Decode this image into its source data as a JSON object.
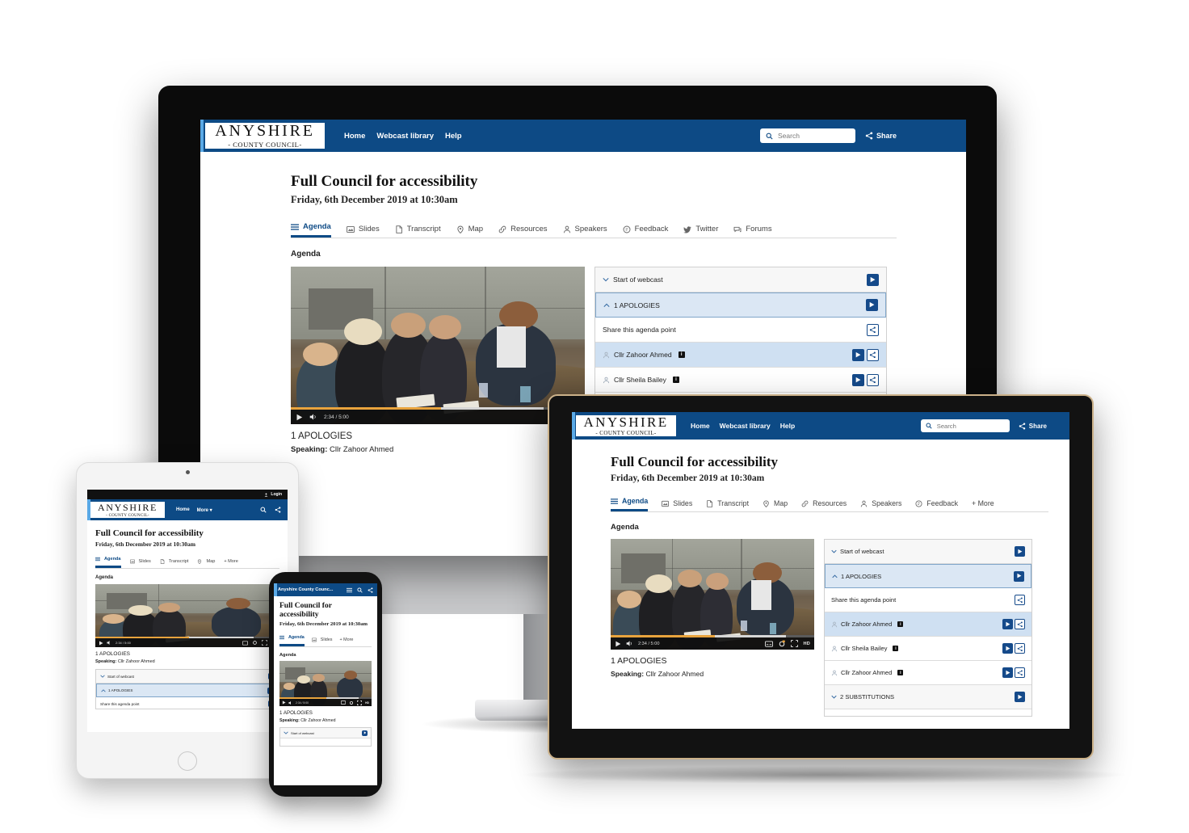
{
  "brand": {
    "logo_line1": "ANYSHIRE",
    "logo_line2": "- COUNTY COUNCIL-",
    "logo_short": "Anyshire County Counc...",
    "primary_color": "#0d4a85",
    "accent_color": "#5aa9e6",
    "button_blue": "#154a8a"
  },
  "nav": {
    "home": "Home",
    "webcast_library": "Webcast library",
    "help": "Help",
    "more": "More",
    "more_caret": "More ▾",
    "login": "Login",
    "share": "Share",
    "search_placeholder": "Search",
    "search_value": ""
  },
  "page": {
    "title": "Full Council for accessibility",
    "subtitle": "Friday, 6th December 2019 at 10:30am",
    "section_label": "Agenda"
  },
  "tabs_desktop": [
    {
      "label": "Agenda",
      "icon": "list-icon",
      "active": true
    },
    {
      "label": "Slides",
      "icon": "slides-icon",
      "active": false
    },
    {
      "label": "Transcript",
      "icon": "document-icon",
      "active": false
    },
    {
      "label": "Map",
      "icon": "map-pin-icon",
      "active": false
    },
    {
      "label": "Resources",
      "icon": "link-icon",
      "active": false
    },
    {
      "label": "Speakers",
      "icon": "person-icon",
      "active": false
    },
    {
      "label": "Feedback",
      "icon": "comment-icon",
      "active": false
    },
    {
      "label": "Twitter",
      "icon": "twitter-icon",
      "active": false
    },
    {
      "label": "Forums",
      "icon": "forums-icon",
      "active": false
    }
  ],
  "tabs_laptop": [
    {
      "label": "Agenda",
      "icon": "list-icon",
      "active": true
    },
    {
      "label": "Slides",
      "icon": "slides-icon",
      "active": false
    },
    {
      "label": "Transcript",
      "icon": "document-icon",
      "active": false
    },
    {
      "label": "Map",
      "icon": "map-pin-icon",
      "active": false
    },
    {
      "label": "Resources",
      "icon": "link-icon",
      "active": false
    },
    {
      "label": "Speakers",
      "icon": "person-icon",
      "active": false
    },
    {
      "label": "Feedback",
      "icon": "comment-icon",
      "active": false
    },
    {
      "label": "+ More",
      "icon": "plus-icon",
      "active": false
    }
  ],
  "tabs_tablet": [
    {
      "label": "Agenda",
      "icon": "list-icon",
      "active": true
    },
    {
      "label": "Slides",
      "icon": "slides-icon",
      "active": false
    },
    {
      "label": "Transcript",
      "icon": "document-icon",
      "active": false
    },
    {
      "label": "Map",
      "icon": "map-pin-icon",
      "active": false
    },
    {
      "label": "+ More",
      "icon": "plus-icon",
      "active": false
    }
  ],
  "tabs_phone": [
    {
      "label": "Agenda",
      "icon": "list-icon",
      "active": true
    },
    {
      "label": "Slides",
      "icon": "slides-icon",
      "active": false
    },
    {
      "label": "+ More",
      "icon": "plus-icon",
      "active": false
    }
  ],
  "player": {
    "current_time": "2:34",
    "duration": "5:00",
    "time_display": "2:34 / 5:00",
    "progress_percent": 51,
    "buffered_percent": 86,
    "quality": "HD",
    "controls": [
      "play-icon",
      "volume-icon",
      "captions-icon",
      "settings-icon",
      "fullscreen-icon",
      "hd-badge"
    ]
  },
  "now_playing": {
    "agenda_item": "1 APOLOGIES",
    "speaking_label": "Speaking:",
    "speaker_name": "Cllr Zahoor Ahmed"
  },
  "agenda_rows": [
    {
      "type": "item",
      "label": "Start of webcast",
      "chevron": "down",
      "selected": false,
      "buttons": [
        "play"
      ]
    },
    {
      "type": "item",
      "label": "1 APOLOGIES",
      "chevron": "up",
      "selected": true,
      "buttons": [
        "play"
      ]
    },
    {
      "type": "share",
      "label": "Share this agenda point",
      "chevron": null,
      "selected": false,
      "buttons": [
        "share"
      ]
    },
    {
      "type": "speaker",
      "label": "Cllr Zahoor Ahmed",
      "chevron": null,
      "selected": true,
      "badge": "i",
      "buttons": [
        "play",
        "share"
      ]
    },
    {
      "type": "speaker",
      "label": "Cllr Sheila Bailey",
      "chevron": null,
      "selected": false,
      "badge": "i",
      "buttons": [
        "play",
        "share"
      ]
    },
    {
      "type": "speaker",
      "label": "Cllr Zahoor Ahmed",
      "chevron": null,
      "selected": false,
      "badge": "i",
      "buttons": [
        "play",
        "share"
      ]
    },
    {
      "type": "item",
      "label": "2 SUBSTITUTIONS",
      "chevron": "down",
      "selected": false,
      "buttons": [
        "play"
      ]
    }
  ]
}
